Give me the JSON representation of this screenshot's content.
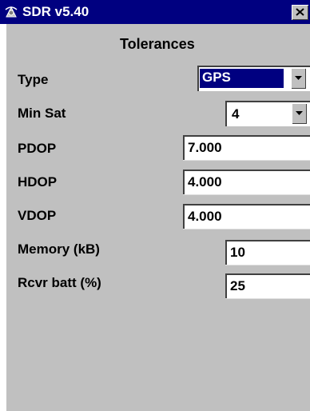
{
  "window": {
    "title": "SDR v5.40",
    "close_icon": "close-icon",
    "app_icon": "sdr-app-icon"
  },
  "panel": {
    "heading": "Tolerances"
  },
  "fields": {
    "type": {
      "label": "Type",
      "value": "GPS"
    },
    "min_sat": {
      "label": "Min Sat",
      "value": "4"
    },
    "pdop": {
      "label": "PDOP",
      "value": "7.000"
    },
    "hdop": {
      "label": "HDOP",
      "value": "4.000"
    },
    "vdop": {
      "label": "VDOP",
      "value": "4.000"
    },
    "memory": {
      "label": "Memory (kB)",
      "value": "10"
    },
    "rcvr_batt": {
      "label": "Rcvr batt (%)",
      "value": "25"
    }
  },
  "colors": {
    "titlebar": "#000080",
    "face": "#c0c0c0",
    "selection": "#000080"
  }
}
